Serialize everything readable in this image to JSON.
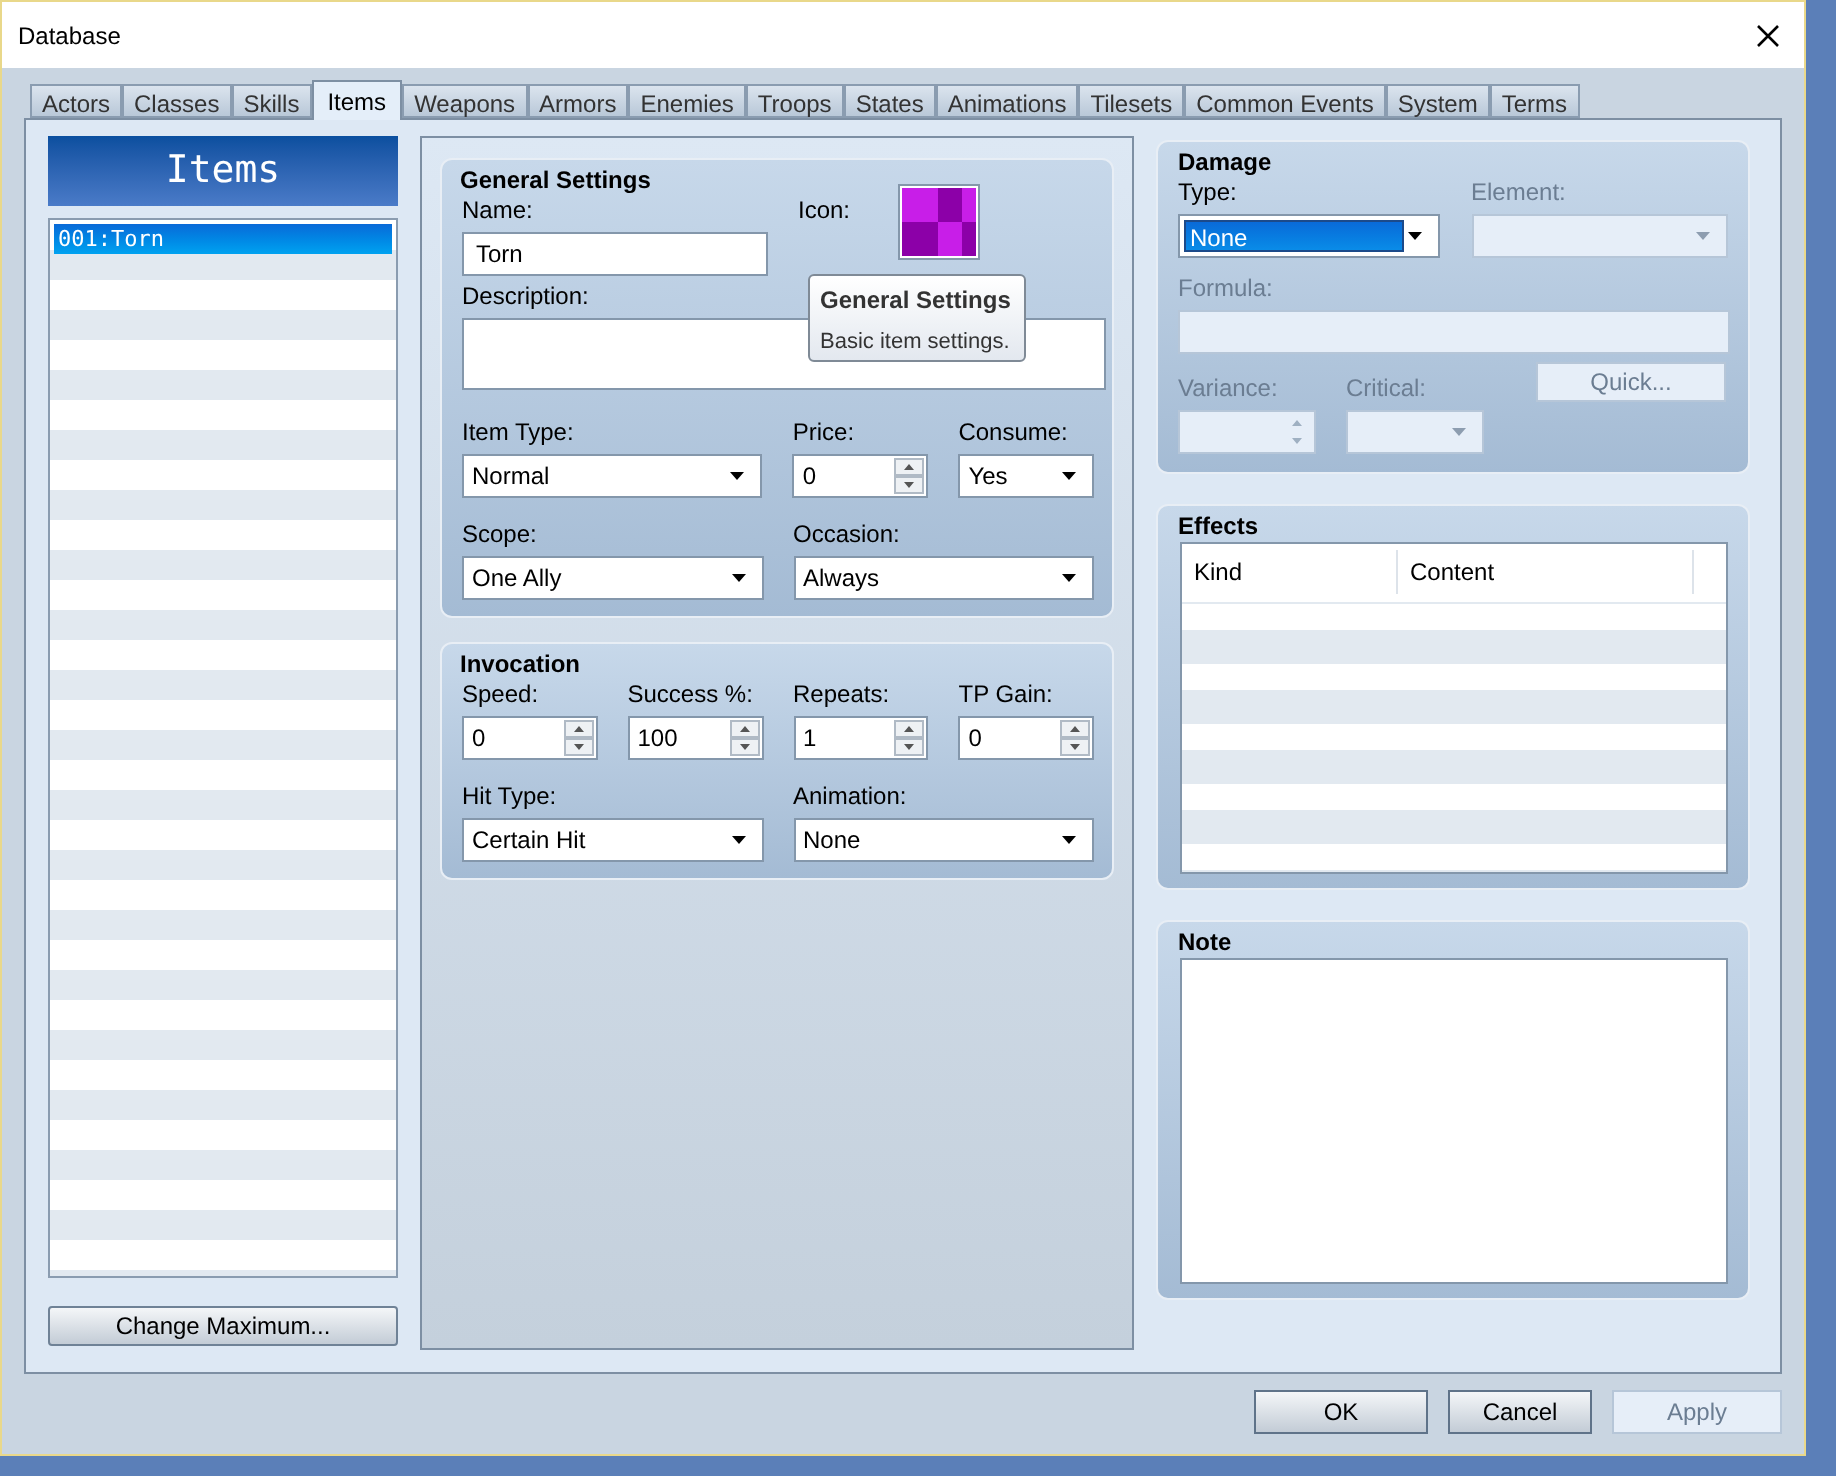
{
  "window": {
    "title": "Database"
  },
  "tabs": [
    {
      "label": "Actors",
      "selected": false
    },
    {
      "label": "Classes",
      "selected": false
    },
    {
      "label": "Skills",
      "selected": false
    },
    {
      "label": "Items",
      "selected": true
    },
    {
      "label": "Weapons",
      "selected": false
    },
    {
      "label": "Armors",
      "selected": false
    },
    {
      "label": "Enemies",
      "selected": false
    },
    {
      "label": "Troops",
      "selected": false
    },
    {
      "label": "States",
      "selected": false
    },
    {
      "label": "Animations",
      "selected": false
    },
    {
      "label": "Tilesets",
      "selected": false
    },
    {
      "label": "Common Events",
      "selected": false
    },
    {
      "label": "System",
      "selected": false
    },
    {
      "label": "Terms",
      "selected": false
    }
  ],
  "items_panel": {
    "title": "Items",
    "items": [
      {
        "label": "001:Torn",
        "selected": true
      }
    ],
    "change_maximum": "Change Maximum..."
  },
  "general_settings": {
    "title": "General Settings",
    "name": {
      "label": "Name:",
      "value": "Torn"
    },
    "icon": {
      "label": "Icon:"
    },
    "description": {
      "label": "Description:"
    },
    "item_type": {
      "label": "Item Type:",
      "value": "Normal"
    },
    "price": {
      "label": "Price:",
      "value": "0"
    },
    "consume": {
      "label": "Consume:",
      "value": "Yes"
    },
    "scope": {
      "label": "Scope:",
      "value": "One Ally"
    },
    "occasion": {
      "label": "Occasion:",
      "value": "Always"
    }
  },
  "tooltip": {
    "title": "General Settings",
    "text": "Basic item settings."
  },
  "invocation": {
    "title": "Invocation",
    "speed": {
      "label": "Speed:",
      "value": "0"
    },
    "success": {
      "label": "Success %:",
      "value": "100"
    },
    "repeats": {
      "label": "Repeats:",
      "value": "1"
    },
    "tp_gain": {
      "label": "TP Gain:",
      "value": "0"
    },
    "hit_type": {
      "label": "Hit Type:",
      "value": "Certain Hit"
    },
    "animation": {
      "label": "Animation:",
      "value": "None"
    }
  },
  "damage": {
    "title": "Damage",
    "type": {
      "label": "Type:",
      "value": "None",
      "disabled": false,
      "focused": true
    },
    "element": {
      "label": "Element:",
      "disabled": true
    },
    "formula": {
      "label": "Formula:",
      "disabled": true
    },
    "variance": {
      "label": "Variance:",
      "disabled": true
    },
    "critical": {
      "label": "Critical:",
      "disabled": true
    },
    "quick": {
      "label": "Quick...",
      "disabled": true
    }
  },
  "effects": {
    "title": "Effects",
    "columns": [
      "Kind",
      "Content"
    ]
  },
  "note": {
    "title": "Note"
  },
  "buttons": [
    {
      "label": "OK",
      "disabled": false
    },
    {
      "label": "Cancel",
      "disabled": false
    },
    {
      "label": "Apply",
      "disabled": true
    }
  ]
}
